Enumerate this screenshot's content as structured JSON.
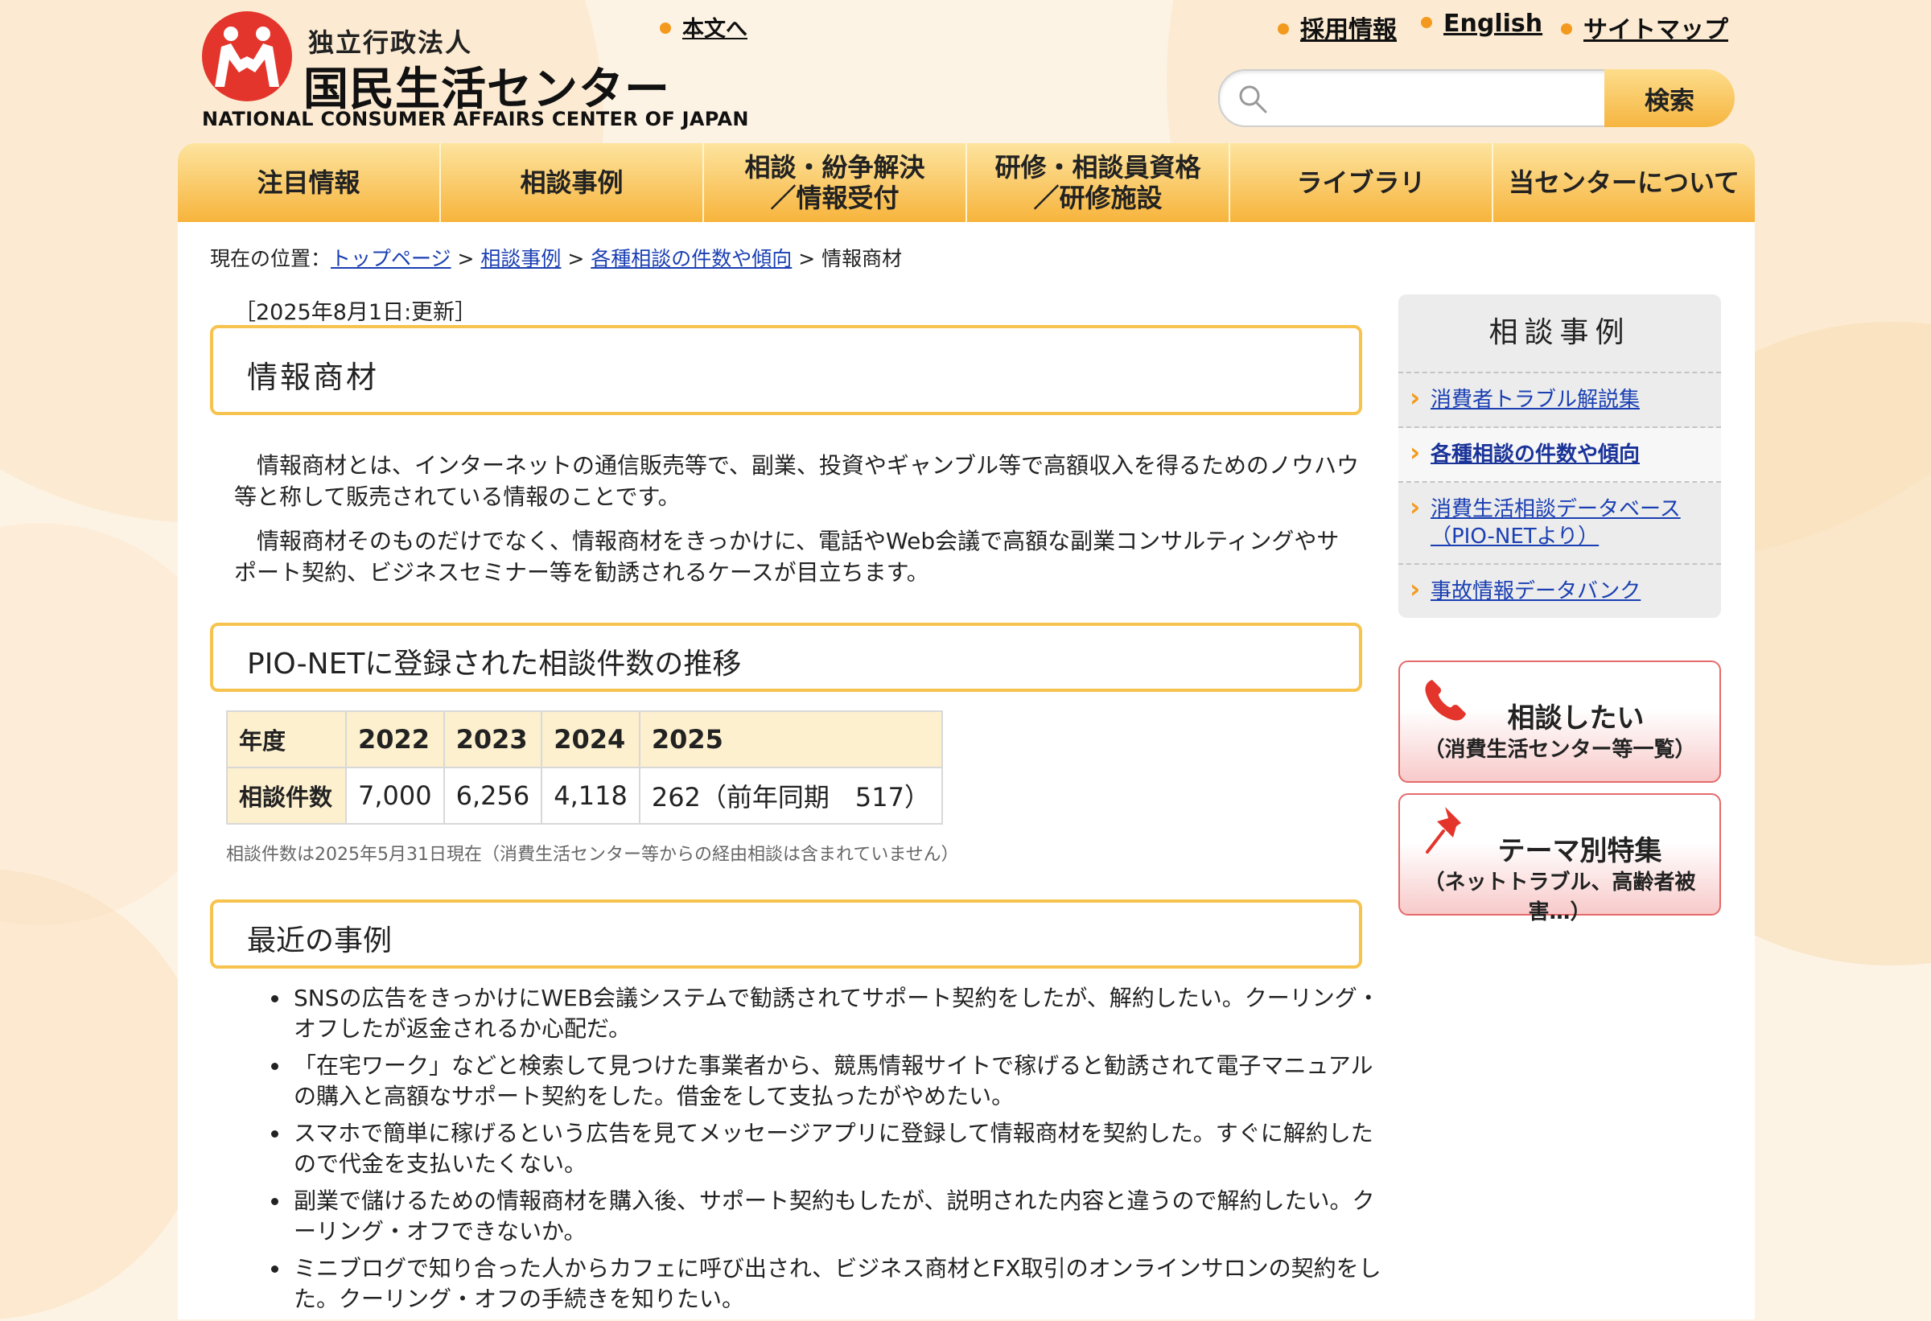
{
  "header": {
    "logo_sub": "独立行政法人",
    "logo_main": "国民生活センター",
    "logo_en": "NATIONAL CONSUMER AFFAIRS CENTER OF JAPAN",
    "skip_link": "本文へ",
    "top_links": [
      "採用情報",
      "English",
      "サイトマップ"
    ],
    "search": {
      "placeholder": "",
      "button": "検索"
    }
  },
  "global_nav": [
    "注目情報",
    "相談事例",
    "相談・紛争解決\n／情報受付",
    "研修・相談員資格\n／研修施設",
    "ライブラリ",
    "当センターについて"
  ],
  "breadcrumb": {
    "prefix": "現在の位置：",
    "items": [
      "トップページ",
      "相談事例",
      "各種相談の件数や傾向"
    ],
    "current": "情報商材",
    "separator": ">"
  },
  "updated": "［2025年8月1日:更新］",
  "page_title": "情報商材",
  "lead": [
    "情報商材とは、インターネットの通信販売等で、副業、投資やギャンブル等で高額収入を得るためのノウハウ等と称して販売されている情報のことです。",
    "情報商材そのものだけでなく、情報商材をきっかけに、電話やWeb会議で高額な副業コンサルティングやサポート契約、ビジネスセミナー等を勧誘されるケースが目立ちます。"
  ],
  "section_counts": {
    "heading": "PIO-NETに登録された相談件数の推移",
    "table": {
      "header_label": "年度",
      "years": [
        "2022",
        "2023",
        "2024",
        "2025"
      ],
      "row_label": "相談件数",
      "values": [
        "7,000",
        "6,256",
        "4,118",
        "262（前年同期　517）"
      ]
    },
    "note": "相談件数は2025年5月31日現在（消費生活センター等からの経由相談は含まれていません）"
  },
  "section_cases": {
    "heading": "最近の事例",
    "items": [
      "SNSの広告をきっかけにWEB会議システムで勧誘されてサポート契約をしたが、解約したい。クーリング・オフしたが返金されるか心配だ。",
      "「在宅ワーク」などと検索して見つけた事業者から、競馬情報サイトで稼げると勧誘されて電子マニュアルの購入と高額なサポート契約をした。借金をして支払ったがやめたい。",
      "スマホで簡単に稼げるという広告を見てメッセージアプリに登録して情報商材を契約した。すぐに解約したので代金を支払いたくない。",
      "副業で儲けるための情報商材を購入後、サポート契約もしたが、説明された内容と違うので解約したい。クーリング・オフできないか。",
      "ミニブログで知り合った人からカフェに呼び出され、ビジネス商材とFX取引のオンラインサロンの契約をした。クーリング・オフの手続きを知りたい。"
    ]
  },
  "sidebar": {
    "title": "相談事例",
    "items": [
      "消費者トラブル解説集",
      "各種相談の件数や傾向",
      "消費生活相談データベース（PIO-NETより）",
      "事故情報データバンク"
    ],
    "current_index": 1,
    "banners": [
      {
        "title": "相談したい",
        "subtitle": "（消費生活センター等一覧）",
        "icon": "phone-icon"
      },
      {
        "title": "テーマ別特集",
        "subtitle": "（ネットトラブル、高齢者被害…）",
        "icon": "pushpin-icon"
      }
    ]
  },
  "colors": {
    "accent_orange": "#f39a1e",
    "nav_gold": "#f7b43c",
    "heading_border": "#f7c34f",
    "link_blue": "#1a3fb3",
    "brand_red": "#e3352b",
    "banner_red": "#e56a6a"
  }
}
